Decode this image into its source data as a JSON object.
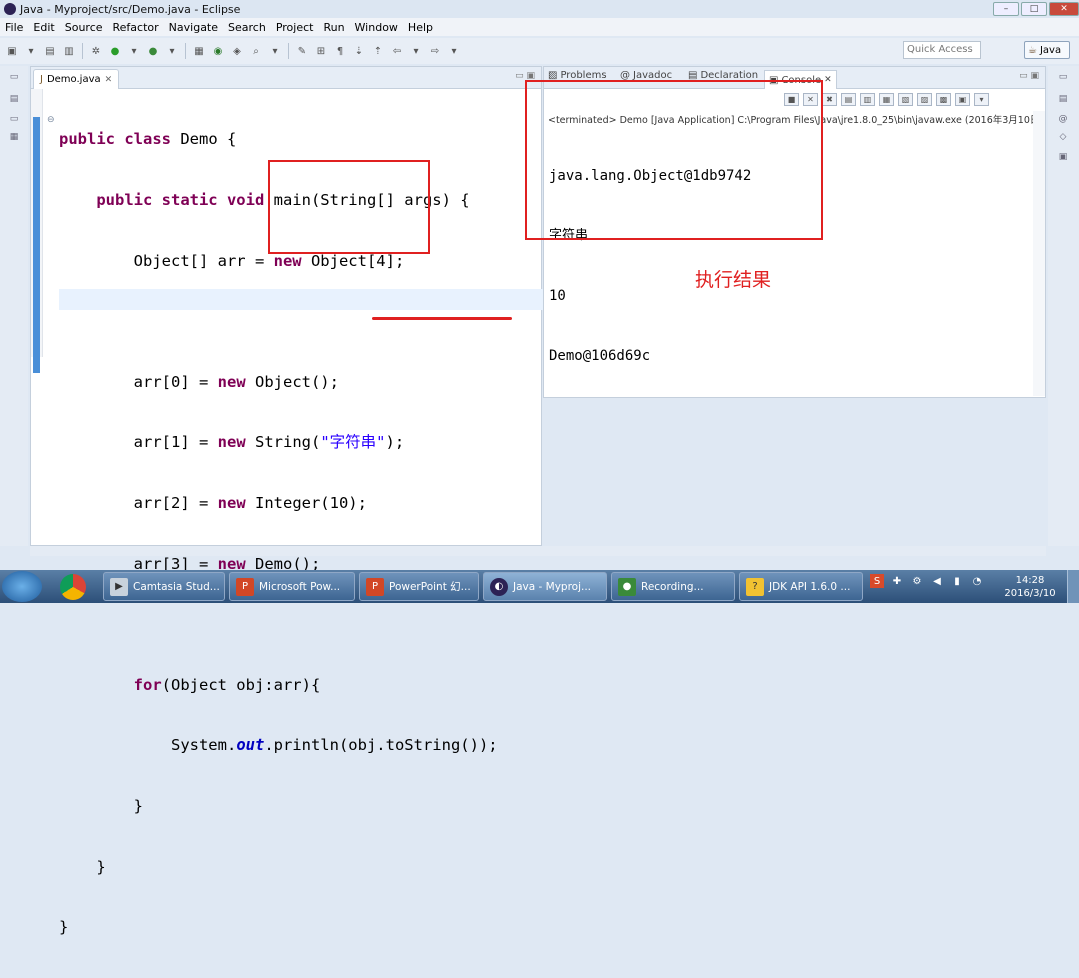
{
  "window": {
    "title": "Java - Myproject/src/Demo.java - Eclipse",
    "controls": [
      "–",
      "□",
      "✕"
    ]
  },
  "menu": [
    "File",
    "Edit",
    "Source",
    "Refactor",
    "Navigate",
    "Search",
    "Project",
    "Run",
    "Window",
    "Help"
  ],
  "toolbar": {
    "quick_access_placeholder": "Quick Access",
    "perspective": "Java"
  },
  "editor": {
    "tab_label": "Demo.java",
    "code": {
      "l1_kw": "public class ",
      "l1_rest": "Demo {",
      "l2_kw": "public static void ",
      "l2_rest": "main(String[] args) {",
      "l3_a": "Object[] arr = ",
      "l3_kw": "new",
      "l3_b": " Object[4];",
      "l5_a": "arr[0] = ",
      "l5_kw": "new",
      "l5_b": " Object();",
      "l6_a": "arr[1] = ",
      "l6_kw": "new",
      "l6_b": " String(",
      "l6_str": "\"字符串\"",
      "l6_c": ");",
      "l7_a": "arr[2] = ",
      "l7_kw": "new",
      "l7_b": " Integer(10);",
      "l8_a": "arr[3] = ",
      "l8_kw": "new",
      "l8_b": " Demo();",
      "l10_kw": "for",
      "l10_rest": "(Object obj:arr){",
      "l11_a": "System.",
      "l11_fld": "out",
      "l11_b": ".println(obj.toString());",
      "l12": "}",
      "l13": "}",
      "l14": "}"
    }
  },
  "console": {
    "tabs": [
      "Problems",
      "Javadoc",
      "Declaration",
      "Console"
    ],
    "terminated": "<terminated> Demo [Java Application] C:\\Program Files\\Java\\jre1.8.0_25\\bin\\javaw.exe (2016年3月10日",
    "output": [
      "java.lang.Object@1db9742",
      "字符串",
      "10",
      "Demo@106d69c"
    ]
  },
  "annotation": {
    "caption": "执行结果",
    "color": "#e02020"
  },
  "taskbar": {
    "items": [
      "Camtasia Stud...",
      "Microsoft Pow...",
      "PowerPoint 幻...",
      "Java - Myproj...",
      "Recording...",
      "JDK API 1.6.0 ..."
    ],
    "time": "14:28",
    "date": "2016/3/10"
  },
  "colors": {
    "keyword": "#7f0055",
    "string": "#2a00ff",
    "field": "#0000c0",
    "selection": "#4a8fd8"
  }
}
